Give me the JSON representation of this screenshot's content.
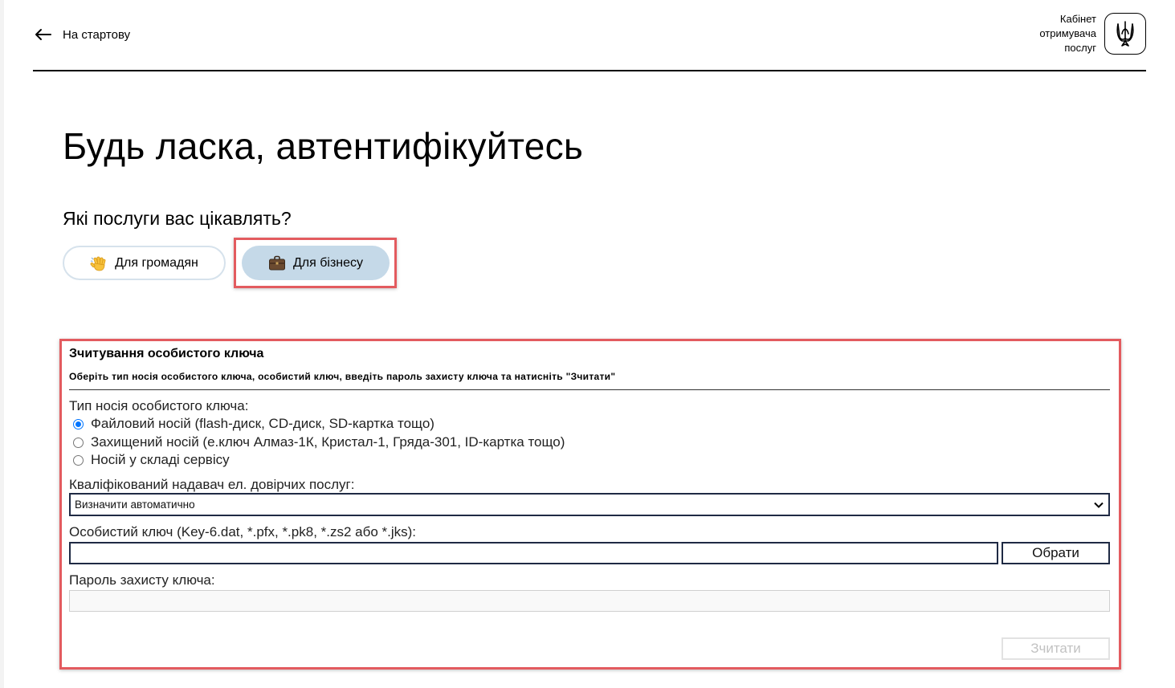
{
  "header": {
    "back_label": "На стартову",
    "cabinet_lines": [
      "Кабінет",
      "отримувача",
      "послуг"
    ]
  },
  "main": {
    "title": "Будь ласка, автентифікуйтесь",
    "question": "Які послуги вас цікавлять?",
    "service_tabs": [
      {
        "label": "Для громадян",
        "icon": "waving-hand-icon",
        "selected": false
      },
      {
        "label": "Для бізнесу",
        "icon": "briefcase-icon",
        "selected": true
      }
    ]
  },
  "form": {
    "title": "Зчитування особистого ключа",
    "subtitle": "Оберіть тип носія особистого ключа, особистий ключ, введіть пароль захисту ключа та натисніть \"Зчитати\"",
    "media_type_label": "Тип носія особистого ключа:",
    "media_options": [
      {
        "label": "Файловий носій (flash-диск, CD-диск, SD-картка тощо)",
        "checked": true
      },
      {
        "label": "Захищений носій (е.ключ Алмаз-1К, Кристал-1, Гряда-301, ID-картка тощо)",
        "checked": false
      },
      {
        "label": "Носій у складі сервісу",
        "checked": false
      }
    ],
    "provider_label": "Кваліфікований надавач ел. довірчих послуг:",
    "provider_value": "Визначити автоматично",
    "key_label": "Особистий ключ (Key-6.dat, *.pfx, *.pk8, *.zs2 або *.jks):",
    "key_value": "",
    "choose_button": "Обрати",
    "password_label": "Пароль захисту ключа:",
    "password_value": "",
    "read_button": "Зчитати"
  },
  "colors": {
    "highlight": "#e35b5f",
    "selected_tab_bg": "#c5d9e8",
    "unselected_tab_border": "#d6e2ec",
    "radio_checked": "#0075ff",
    "input_border": "#1f2a44"
  }
}
